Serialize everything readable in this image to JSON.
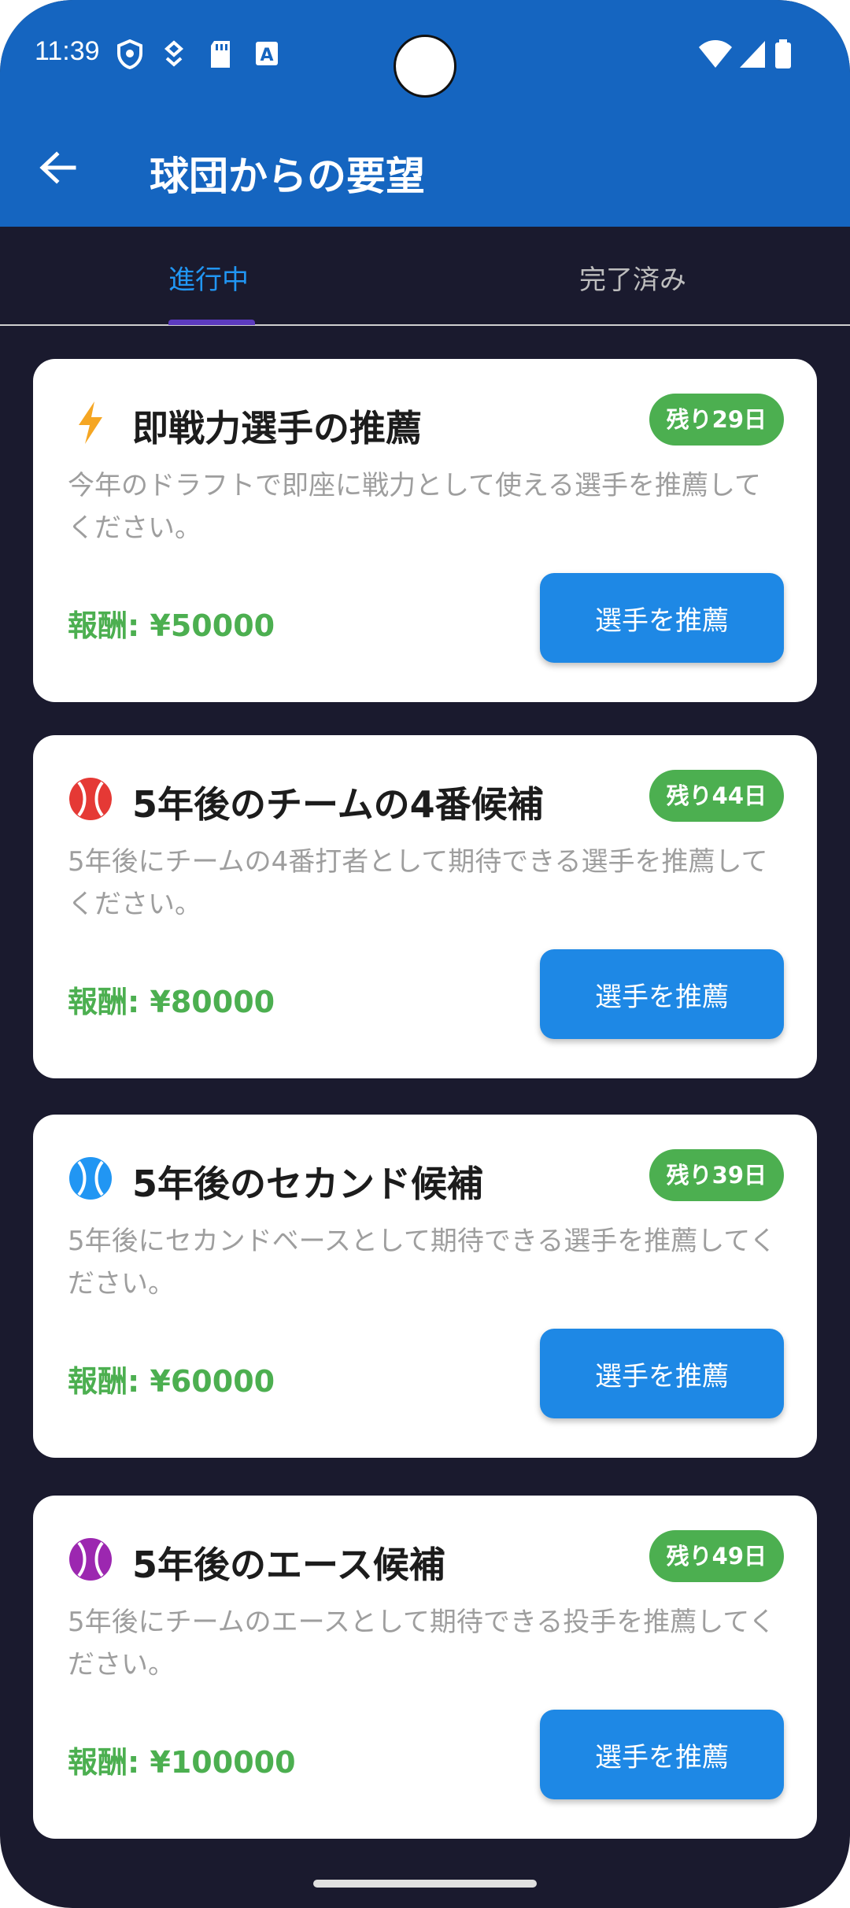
{
  "status_bar": {
    "time": "11:39"
  },
  "app_bar": {
    "title": "球団からの要望"
  },
  "tabs": [
    {
      "label": "進行中",
      "active": true
    },
    {
      "label": "完了済み",
      "active": false
    }
  ],
  "cards": [
    {
      "icon": "lightning-icon",
      "icon_color": "#f5a623",
      "title": "即戦力選手の推薦",
      "badge": "残り29日",
      "description": "今年のドラフトで即座に戦力として使える選手を推薦してください。",
      "reward": "報酬: ¥50000",
      "button": "選手を推薦"
    },
    {
      "icon": "baseball-icon",
      "icon_color": "#e53935",
      "title": "5年後のチームの4番候補",
      "badge": "残り44日",
      "description": "5年後にチームの4番打者として期待できる選手を推薦してください。",
      "reward": "報酬: ¥80000",
      "button": "選手を推薦"
    },
    {
      "icon": "baseball-icon",
      "icon_color": "#2196f3",
      "title": "5年後のセカンド候補",
      "badge": "残り39日",
      "description": "5年後にセカンドベースとして期待できる選手を推薦してください。",
      "reward": "報酬: ¥60000",
      "button": "選手を推薦"
    },
    {
      "icon": "baseball-icon",
      "icon_color": "#9c27b0",
      "title": "5年後のエース候補",
      "badge": "残り49日",
      "description": "5年後にチームのエースとして期待できる投手を推薦してください。",
      "reward": "報酬: ¥100000",
      "button": "選手を推薦"
    }
  ],
  "colors": {
    "app_bar": "#1565c0",
    "background": "#1a1a2e",
    "badge": "#4caf50",
    "button": "#1e88e5",
    "reward": "#4caf50",
    "active_tab": "#2196f3"
  }
}
